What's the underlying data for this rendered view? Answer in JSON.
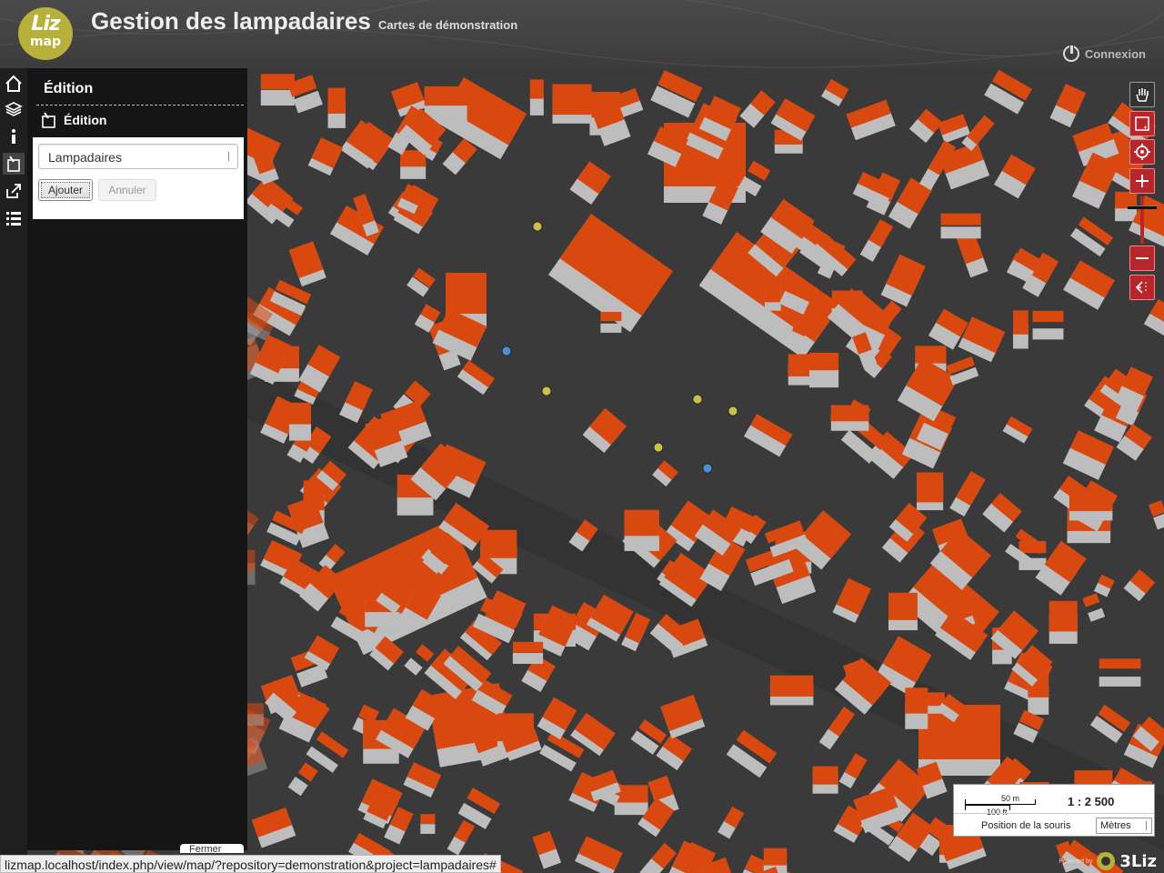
{
  "header": {
    "logo_top": "Liz",
    "logo_bottom": "map",
    "title": "Gestion des lampadaires",
    "subtitle": "Cartes de démonstration",
    "login_label": "Connexion"
  },
  "menu": {
    "items": [
      {
        "name": "home",
        "icon": "home-icon"
      },
      {
        "name": "layers",
        "icon": "layers-icon"
      },
      {
        "name": "metadata",
        "icon": "info-icon"
      },
      {
        "name": "edition",
        "icon": "edit-icon"
      },
      {
        "name": "permalink",
        "icon": "share-icon"
      },
      {
        "name": "legend",
        "icon": "list-icon"
      }
    ]
  },
  "dock": {
    "title": "Édition",
    "subtitle": "Édition",
    "layer_selected": "Lampadaires",
    "add_label": "Ajouter",
    "cancel_label": "Annuler",
    "bottom_tab": "Fermer"
  },
  "map": {
    "background": "#3a3a3a",
    "building_color": "#d9480f",
    "wall_color": "#bdbdbd",
    "lamp_colors": {
      "yellow": "#c8c24a",
      "blue": "#4a8fd9"
    }
  },
  "scale": {
    "metric": "50 m",
    "imperial": "100 ft",
    "value": "1 : 2 500"
  },
  "mouse": {
    "label": "Position de la souris",
    "units": "Mètres"
  },
  "footer": {
    "url": "lizmap.localhost/index.php/view/map/?repository=demonstration&project=lampadaires#",
    "powered_by": "Powered by",
    "brand": "3Liz"
  }
}
